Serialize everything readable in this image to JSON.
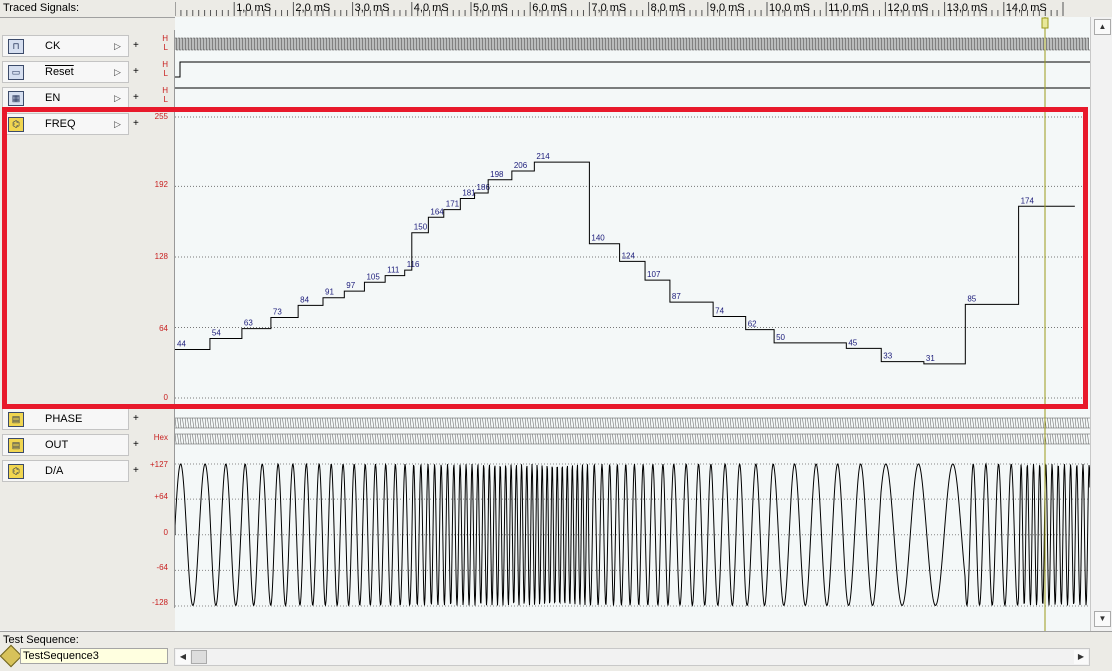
{
  "header": {
    "title": "Traced Signals:"
  },
  "time_axis": [
    "1,0 mS",
    "2,0 mS",
    "3,0 mS",
    "4,0 mS",
    "5,0 mS",
    "6,0 mS",
    "7,0 mS",
    "8,0 mS",
    "9,0 mS",
    "10,0 mS",
    "11,0 mS",
    "12,0 mS",
    "13,0 mS",
    "14,0 mS"
  ],
  "signals": [
    {
      "name": "CK",
      "levels": [
        "H",
        "L"
      ]
    },
    {
      "name": "Reset",
      "levels": [
        "H",
        "L"
      ]
    },
    {
      "name": "EN",
      "levels": [
        "H",
        "L"
      ]
    },
    {
      "name": "FREQ",
      "levels": [
        "255",
        "192",
        "128",
        "64",
        "0"
      ]
    },
    {
      "name": "PHASE",
      "levels": [
        "Hex"
      ]
    },
    {
      "name": "OUT",
      "levels": [
        "Hex"
      ]
    },
    {
      "name": "D/A",
      "levels": [
        "+127",
        "+64",
        "0",
        "-64",
        "-128"
      ]
    }
  ],
  "freq_values": [
    44,
    54,
    63,
    73,
    84,
    91,
    97,
    105,
    111,
    116,
    150,
    164,
    171,
    181,
    186,
    198,
    206,
    214,
    140,
    124,
    107,
    87,
    74,
    62,
    50,
    45,
    33,
    31,
    85,
    174
  ],
  "footer": {
    "test_sequence_label": "Test Sequence:",
    "test_sequence_value": "TestSequence3"
  },
  "colors": {
    "highlight": "#e8192b",
    "cursor": "#9a9a1a",
    "scale_text": "#c82020",
    "value_text": "#1b1b7a"
  }
}
